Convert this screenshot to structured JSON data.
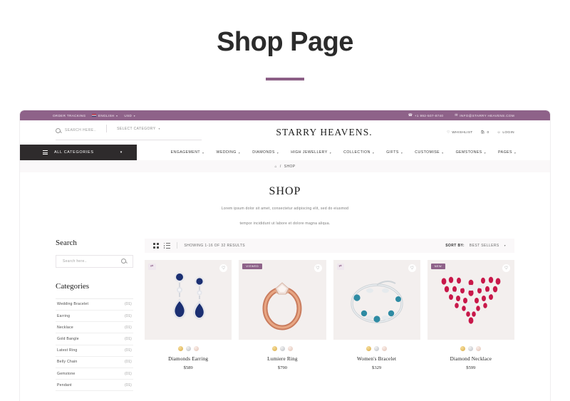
{
  "page": {
    "title": "Shop Page"
  },
  "topbar": {
    "order_tracking": "ORDER TRACKING",
    "language": "ENGLISH",
    "currency": "USD",
    "phone": "+1 992-507-8740",
    "email": "INFO@STARRY HEAVENS.COM",
    "accent_color": "#8e6289"
  },
  "header": {
    "search_placeholder": "SEARCH HERE..",
    "select_category": "SELECT CATEGORY",
    "logo": "STARRY HEAVENS.",
    "wishlist": "WHISHLIST",
    "cart_count": "0",
    "login": "LOGIN"
  },
  "nav": {
    "all_categories": "ALL CATEGORIES",
    "items": [
      {
        "label": "ENGAGEMENT"
      },
      {
        "label": "WEDDING"
      },
      {
        "label": "DIAMONDS"
      },
      {
        "label": "HIGH JEWELLERY"
      },
      {
        "label": "COLLECTION"
      },
      {
        "label": "GIFTS"
      },
      {
        "label": "CUSTOMISE"
      },
      {
        "label": "GEMSTONES"
      },
      {
        "label": "PAGES"
      }
    ]
  },
  "breadcrumb": {
    "home_icon": "home-icon",
    "separator": "/",
    "current": "SHOP"
  },
  "hero": {
    "heading": "SHOP",
    "line1": "Lorem ipsum dolor sit amet, consectetur adipiscing elit, sed do eiusmod",
    "line2": "tempor incididunt ut labore et dolore magna aliqua."
  },
  "sidebar": {
    "search_heading": "Search",
    "search_placeholder": "Search here..",
    "categories_heading": "Categories",
    "categories": [
      {
        "label": "Wedding Bracelet",
        "count": "(01)"
      },
      {
        "label": "Earring",
        "count": "(01)"
      },
      {
        "label": "Necklace",
        "count": "(01)"
      },
      {
        "label": "Gold Bangle",
        "count": "(01)"
      },
      {
        "label": "Latest Ring",
        "count": "(01)"
      },
      {
        "label": "Belly Chain",
        "count": "(01)"
      },
      {
        "label": "Gemstone",
        "count": "(01)"
      },
      {
        "label": "Pendant",
        "count": "(01)"
      }
    ]
  },
  "toolbar": {
    "showing": "SHOWING 1-16 OF 32 RESULTS",
    "sort_label": "SORT BY:",
    "sort_value": "BEST SELLERS"
  },
  "products": [
    {
      "name": "Diamonds Earring",
      "price": "$589",
      "badge": "",
      "badge_type": "compare-icon",
      "swatches": [
        "gold",
        "silver",
        "rose"
      ]
    },
    {
      "name": "Lumiere Ring",
      "price": "$790",
      "badge": "VIEWED",
      "badge_type": "text",
      "swatches": [
        "gold",
        "silver",
        "rose"
      ]
    },
    {
      "name": "Women's Bracelet",
      "price": "$329",
      "badge": "",
      "badge_type": "compare-icon",
      "swatches": [
        "gold",
        "silver",
        "rose"
      ]
    },
    {
      "name": "Diamond Necklace",
      "price": "$599",
      "badge": "NEW",
      "badge_type": "text",
      "swatches": [
        "gold",
        "silver",
        "rose"
      ]
    }
  ]
}
